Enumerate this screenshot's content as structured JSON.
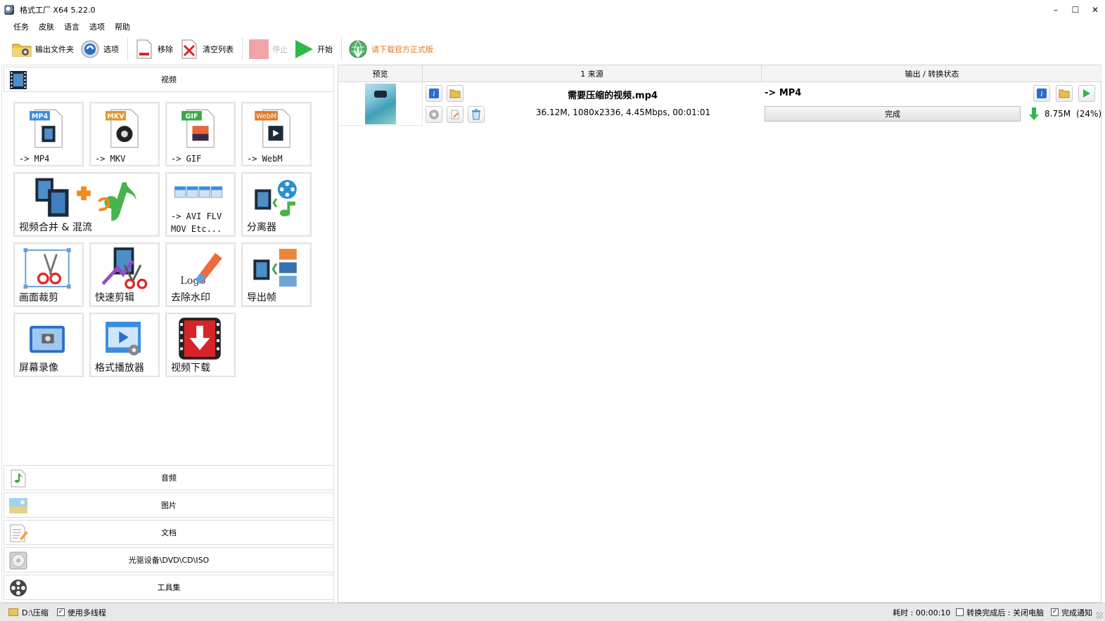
{
  "window": {
    "title": "格式工厂 X64 5.22.0",
    "controls": [
      "–",
      "☐",
      "✕"
    ]
  },
  "menu": [
    "任务",
    "皮肤",
    "语言",
    "选项",
    "帮助"
  ],
  "toolbar": {
    "output_folder": "输出文件夹",
    "options": "选项",
    "remove": "移除",
    "clear_list": "清空列表",
    "stop": "停止",
    "start": "开始",
    "download_official": "请下载官方正式版"
  },
  "left": {
    "video_category": "视频",
    "tiles": [
      {
        "label": "-> MP4",
        "badge": "MP4",
        "badge_color": "#3a8de0"
      },
      {
        "label": "-> MKV",
        "badge": "MKV",
        "badge_color": "#e0952a"
      },
      {
        "label": "-> GIF",
        "badge": "GIF",
        "badge_color": "#3aa84a"
      },
      {
        "label": "-> WebM",
        "badge": "WebM",
        "badge_color": "#e07a2a"
      },
      {
        "label": "视频合并 & 混流"
      },
      {
        "label_line1": "-> AVI FLV",
        "label_line2": "MOV Etc..."
      },
      {
        "label": "分离器"
      },
      {
        "label": "画面裁剪"
      },
      {
        "label": "快速剪辑"
      },
      {
        "label": "去除水印",
        "art_text": "Logo"
      },
      {
        "label": "导出帧"
      },
      {
        "label": "屏幕录像"
      },
      {
        "label": "格式播放器"
      },
      {
        "label": "视频下载"
      }
    ],
    "categories": [
      "音频",
      "图片",
      "文档",
      "光驱设备\\DVD\\CD\\ISO",
      "工具集"
    ]
  },
  "grid": {
    "headers": [
      "预览",
      "1 来源",
      "输出 / 转换状态"
    ],
    "rows": [
      {
        "source_name": "需要压缩的视频.mp4",
        "source_info": "36.12M, 1080x2336, 4.45Mbps, 00:01:01",
        "output_format": "-> MP4",
        "status": "完成",
        "progress": 1.0,
        "output_size": "8.75M",
        "output_ratio": "(24%)"
      }
    ]
  },
  "statusbar": {
    "folder": "D:\\压缩",
    "multithread": "使用多线程",
    "elapsed": "耗时 : 00:00:10",
    "after_convert": "转换完成后 : 关闭电脑",
    "notify": "完成通知"
  },
  "colors": {
    "accent_green": "#2fb84a",
    "download_orange": "#e8741c",
    "info_blue": "#2a6fc9"
  }
}
